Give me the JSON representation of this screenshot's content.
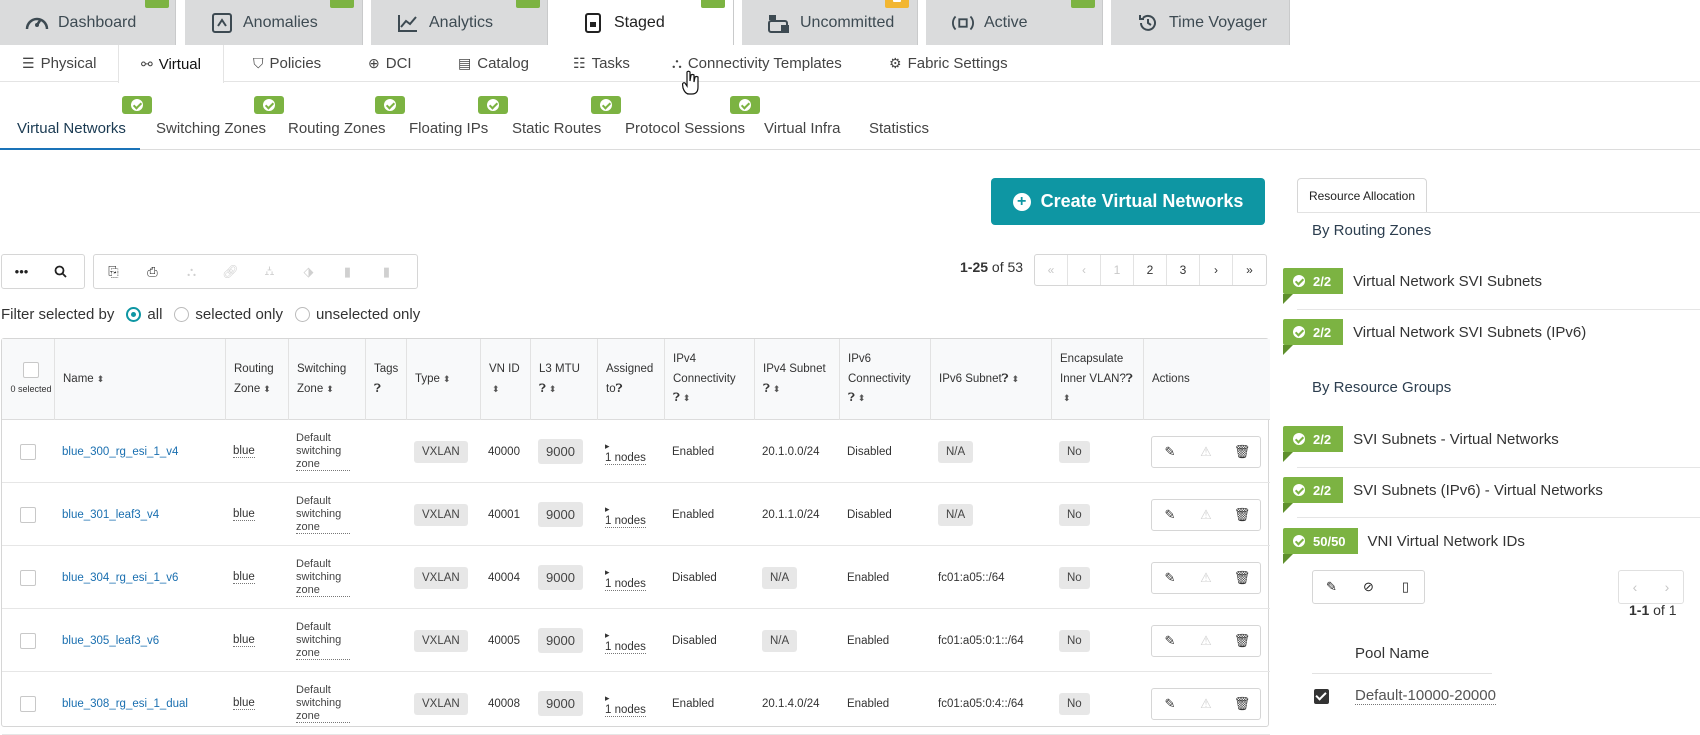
{
  "top_tabs": [
    {
      "label": "Dashboard",
      "icon": "gauge-icon"
    },
    {
      "label": "Anomalies",
      "icon": "shield-icon"
    },
    {
      "label": "Analytics",
      "icon": "line-chart-icon"
    },
    {
      "label": "Staged",
      "icon": "document-lock-icon"
    },
    {
      "label": "Uncommitted",
      "icon": "uncommitted-icon"
    },
    {
      "label": "Active",
      "icon": "broadcast-icon"
    },
    {
      "label": "Time Voyager",
      "icon": "history-icon"
    }
  ],
  "sub_nav": [
    "Physical",
    "Virtual",
    "Policies",
    "DCI",
    "Catalog",
    "Tasks",
    "Connectivity Templates",
    "Fabric Settings"
  ],
  "tabs3": [
    "Virtual Networks",
    "Switching Zones",
    "Routing Zones",
    "Floating IPs",
    "Static Routes",
    "Protocol Sessions",
    "Virtual Infra",
    "Statistics"
  ],
  "create_button": "Create Virtual Networks",
  "pager": {
    "range": "1-25",
    "of": " of 53",
    "pages": [
      "1",
      "2",
      "3"
    ]
  },
  "filter": {
    "label": "Filter selected by",
    "all": "all",
    "selected_only": "selected only",
    "unselected_only": "unselected only"
  },
  "table": {
    "selected_label": "0 selected",
    "headers": {
      "name": "Name",
      "routing_zone_1": "Routing",
      "routing_zone_2": "Zone",
      "switching_zone_1": "Switching",
      "switching_zone_2": "Zone",
      "tags": "Tags",
      "type": "Type",
      "vn_id": "VN ID",
      "l3_mtu": "L3 MTU",
      "assigned_1": "Assigned",
      "assigned_2": "to",
      "ipv4c_1": "IPv4",
      "ipv4c_2": "Connectivity",
      "ipv4s": "IPv4 Subnet",
      "ipv6c_1": "IPv6",
      "ipv6c_2": "Connectivity",
      "ipv6s": "IPv6 Subnet",
      "encap_1": "Encapsulate",
      "encap_2": "Inner VLAN?",
      "actions": "Actions"
    },
    "rows": [
      {
        "name": "blue_300_rg_esi_1_v4",
        "rz": "blue",
        "sz1": "Default",
        "sz2": "switching",
        "sz3": "zone",
        "type": "VXLAN",
        "vnid": "40000",
        "mtu": "9000",
        "assigned": "1 nodes",
        "ipv4c": "Enabled",
        "ipv4s": "20.1.0.0/24",
        "ipv6c": "Disabled",
        "ipv6s": "N/A",
        "encap": "No"
      },
      {
        "name": "blue_301_leaf3_v4",
        "rz": "blue",
        "sz1": "Default",
        "sz2": "switching",
        "sz3": "zone",
        "type": "VXLAN",
        "vnid": "40001",
        "mtu": "9000",
        "assigned": "1 nodes",
        "ipv4c": "Enabled",
        "ipv4s": "20.1.1.0/24",
        "ipv6c": "Disabled",
        "ipv6s": "N/A",
        "encap": "No"
      },
      {
        "name": "blue_304_rg_esi_1_v6",
        "rz": "blue",
        "sz1": "Default",
        "sz2": "switching",
        "sz3": "zone",
        "type": "VXLAN",
        "vnid": "40004",
        "mtu": "9000",
        "assigned": "1 nodes",
        "ipv4c": "Disabled",
        "ipv4s": "N/A",
        "ipv6c": "Enabled",
        "ipv6s": "fc01:a05::/64",
        "encap": "No"
      },
      {
        "name": "blue_305_leaf3_v6",
        "rz": "blue",
        "sz1": "Default",
        "sz2": "switching",
        "sz3": "zone",
        "type": "VXLAN",
        "vnid": "40005",
        "mtu": "9000",
        "assigned": "1 nodes",
        "ipv4c": "Disabled",
        "ipv4s": "N/A",
        "ipv6c": "Enabled",
        "ipv6s": "fc01:a05:0:1::/64",
        "encap": "No"
      },
      {
        "name": "blue_308_rg_esi_1_dual",
        "rz": "blue",
        "sz1": "Default",
        "sz2": "switching",
        "sz3": "zone",
        "type": "VXLAN",
        "vnid": "40008",
        "mtu": "9000",
        "assigned": "1 nodes",
        "ipv4c": "Enabled",
        "ipv4s": "20.1.4.0/24",
        "ipv6c": "Enabled",
        "ipv6s": "fc01:a05:0:4::/64",
        "encap": "No"
      }
    ]
  },
  "resource_panel": {
    "tab": "Resource Allocation",
    "by_routing_zones": "By Routing Zones",
    "by_resource_groups": "By Resource Groups",
    "items": [
      {
        "badge": "2/2",
        "label": "Virtual Network SVI Subnets"
      },
      {
        "badge": "2/2",
        "label": "Virtual Network SVI Subnets (IPv6)"
      },
      {
        "badge": "2/2",
        "label": "SVI Subnets - Virtual Networks"
      },
      {
        "badge": "2/2",
        "label": "SVI Subnets (IPv6) - Virtual Networks"
      },
      {
        "badge": "50/50",
        "label": "VNI Virtual Network IDs"
      }
    ],
    "count_range": "1-1",
    "count_of": " of 1",
    "pool_header": "Pool Name",
    "pool_name": "Default-10000-20000"
  },
  "colors": {
    "accent": "#0e96a3",
    "green": "#7cb342",
    "link": "#1a6fb0"
  }
}
